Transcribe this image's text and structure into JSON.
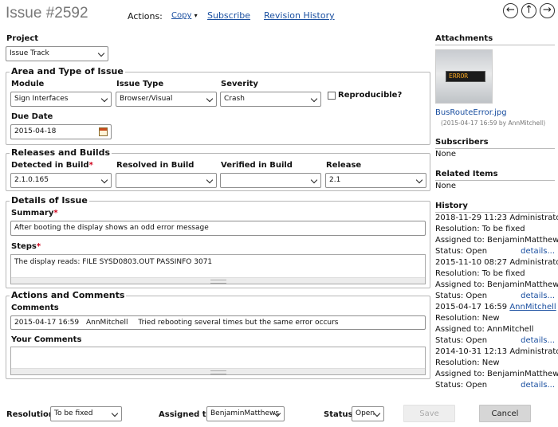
{
  "header": {
    "title": "Issue #2592",
    "actions_label": "Actions:",
    "copy": "Copy",
    "subscribe": "Subscribe",
    "revision_history": "Revision History"
  },
  "project": {
    "label": "Project",
    "value": "Issue Track"
  },
  "area_type": {
    "legend": "Area and Type of Issue",
    "module_label": "Module",
    "module_value": "Sign Interfaces",
    "issue_type_label": "Issue Type",
    "issue_type_value": "Browser/Visual",
    "severity_label": "Severity",
    "severity_value": "Crash",
    "reproducible_label": "Reproducible?",
    "reproducible_checked": false,
    "due_date_label": "Due Date",
    "due_date_value": "2015-04-18"
  },
  "releases": {
    "legend": "Releases and Builds",
    "detected_label": "Detected in Build",
    "detected_value": "2.1.0.165",
    "resolved_label": "Resolved in Build",
    "resolved_value": "",
    "verified_label": "Verified in Build",
    "verified_value": "",
    "release_label": "Release",
    "release_value": "2.1"
  },
  "details": {
    "legend": "Details of Issue",
    "summary_label": "Summary",
    "summary_value": "After booting the display shows an odd error message",
    "steps_label": "Steps",
    "steps_value": "The display reads: FILE SYSD0803.OUT PASSINFO 3071"
  },
  "actions": {
    "legend": "Actions and Comments",
    "comments_label": "Comments",
    "comment_date": "2015-04-17 16:59",
    "comment_user": "AnnMitchell",
    "comment_text": "Tried rebooting several times but the same error occurs",
    "your_comments_label": "Your Comments"
  },
  "sidebar": {
    "attachments_label": "Attachments",
    "attachment_thumb_text": "ERROR",
    "attachment_name": "BusRouteError.jpg",
    "attachment_meta": "(2015-04-17 16:59 by AnnMitchell)",
    "subscribers_label": "Subscribers",
    "subscribers_value": "None",
    "related_label": "Related Items",
    "related_value": "None",
    "history_label": "History",
    "history": [
      {
        "when": "2018-11-29 11:23",
        "who": "Administrator",
        "who_link": false,
        "resolution": "Resolution: To be fixed",
        "assigned": "Assigned to: BenjaminMatthews",
        "status": "Status: Open",
        "details": "details..."
      },
      {
        "when": "2015-11-10 08:27",
        "who": "Administrator",
        "who_link": false,
        "resolution": "Resolution: To be fixed",
        "assigned": "Assigned to: BenjaminMatthews",
        "status": "Status: Open",
        "details": "details..."
      },
      {
        "when": "2015-04-17 16:59",
        "who": "AnnMitchell",
        "who_link": true,
        "resolution": "Resolution: New",
        "assigned": "Assigned to: AnnMitchell",
        "status": "Status: Open",
        "details": "details..."
      },
      {
        "when": "2014-10-31 12:13",
        "who": "Administrator",
        "who_link": false,
        "resolution": "Resolution: New",
        "assigned": "Assigned to: BenjaminMatthews",
        "status": "Status: Open",
        "details": "details..."
      }
    ]
  },
  "footer": {
    "resolution_label": "Resolution:",
    "resolution_value": "To be fixed",
    "assigned_label": "Assigned to:",
    "assigned_value": "BenjaminMatthews",
    "status_label": "Status:",
    "status_value": "Open",
    "save_label": "Save",
    "cancel_label": "Cancel"
  },
  "colors": {
    "link": "#1a4fa0",
    "required": "#d0021b",
    "save_bg": "#eeeeee",
    "cancel_bg": "#d6d6d6"
  },
  "icons": [
    "calendar-icon",
    "back-arrow-icon",
    "up-arrow-icon",
    "forward-arrow-icon",
    "dropdown-caret-icon"
  ]
}
